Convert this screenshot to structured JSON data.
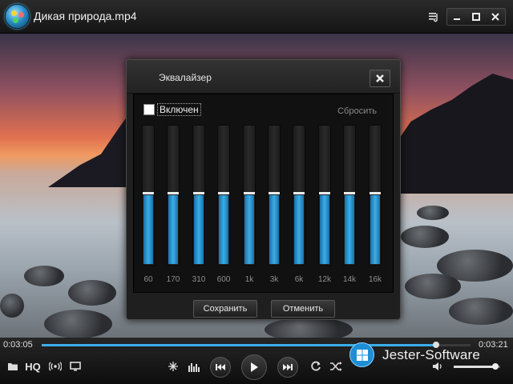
{
  "window": {
    "title": "Дикая природа.mp4"
  },
  "equalizer": {
    "title": "Эквалайзер",
    "enabled_label": "Включен",
    "enabled": false,
    "reset_label": "Сбросить",
    "bands": [
      {
        "label": "60",
        "level": 0.5
      },
      {
        "label": "170",
        "level": 0.5
      },
      {
        "label": "310",
        "level": 0.5
      },
      {
        "label": "600",
        "level": 0.5
      },
      {
        "label": "1k",
        "level": 0.5
      },
      {
        "label": "3k",
        "level": 0.5
      },
      {
        "label": "6k",
        "level": 0.5
      },
      {
        "label": "12k",
        "level": 0.5
      },
      {
        "label": "14k",
        "level": 0.5
      },
      {
        "label": "16k",
        "level": 0.5
      }
    ],
    "save_label": "Сохранить",
    "cancel_label": "Отменить"
  },
  "player": {
    "elapsed": "0:03:05",
    "duration": "0:03:21",
    "progress": 0.92,
    "hq_label": "HQ",
    "volume": 0.9,
    "accent_color": "#3aaee8"
  },
  "watermark": {
    "text": "Jester-Software"
  }
}
